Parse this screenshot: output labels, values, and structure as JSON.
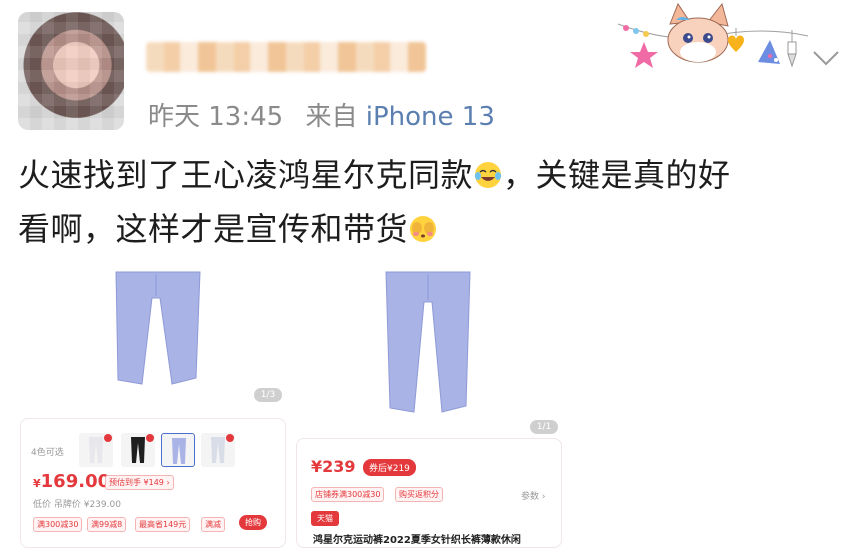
{
  "post": {
    "meta": {
      "time": "昨天 13:45",
      "from_prefix": "来自",
      "device": "iPhone 13"
    },
    "text_line1": "火速找到了王心凌鸿星尔克同款",
    "text_line1b": "，关键是真的好",
    "text_line2": "看啊，这样才是宣传和带货"
  },
  "products": [
    {
      "pager": "1/3",
      "colors_label": "4色可选",
      "price_symbol": "¥",
      "price": "169.00",
      "promo_label": "预估到手 ¥149 ›",
      "orig_price": "低价 吊牌价 ¥239.00",
      "tags": [
        "满300减30",
        "满99减8",
        "最高省149元",
        "满减"
      ],
      "buy_label": "抢购"
    },
    {
      "pager": "1/1",
      "price": "¥239",
      "coupon_price": "券后¥219",
      "tags": [
        "店铺券满300减30",
        "购买返积分"
      ],
      "more_label": "参数 ›",
      "badge": "天猫",
      "title": "鸿星尔克运动裤2022夏季女针织长裤薄款休闲"
    }
  ],
  "colors": {
    "accent_red": "#e4393c",
    "meta_gray": "#8a8a8a",
    "device_blue": "#5b7fb0",
    "pants": "#a9b3e6"
  }
}
